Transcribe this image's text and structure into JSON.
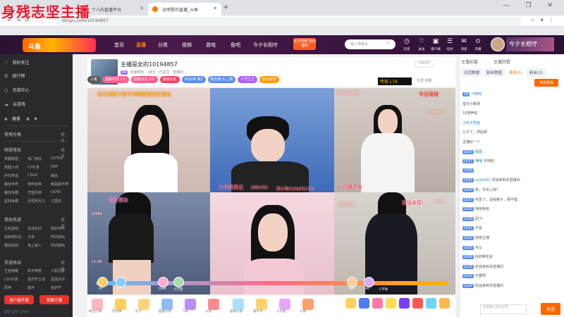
{
  "overlay_title": "身残志坚主播",
  "browser": {
    "tabs": [
      {
        "label": "个人的直播平台"
      },
      {
        "label": "全明星的直播_斗鱼"
      }
    ],
    "url": "douyu.com/10194857",
    "new_tab": "+",
    "window_controls": "— ❐ ✕"
  },
  "header": {
    "logo_text": "斗鱼",
    "nav": [
      "首页",
      "直播",
      "分类",
      "视频",
      "游戏",
      "鱼吧",
      "今夕长相守"
    ],
    "rank_pill": "五月冲榜 活动福利",
    "search_placeholder": "输入搜索关",
    "icons": [
      {
        "icon": "history-icon",
        "label": "历史"
      },
      {
        "icon": "follow-icon",
        "label": "关注"
      },
      {
        "icon": "broadcast-icon",
        "label": "客户端"
      },
      {
        "icon": "task-icon",
        "label": "任务"
      },
      {
        "icon": "message-icon",
        "label": "消息"
      },
      {
        "icon": "location-icon",
        "label": "开播"
      }
    ],
    "banner_text": "今夕长相守"
  },
  "sidebar": {
    "items": [
      {
        "icon": "heart-icon",
        "label": "我的关注"
      },
      {
        "icon": "rank-icon",
        "label": "排行榜"
      },
      {
        "icon": "page-icon",
        "label": "页游中心"
      },
      {
        "icon": "cloud-icon",
        "label": "云游戏"
      },
      {
        "icon": "recommend-icon",
        "label": "赛事"
      }
    ],
    "sections": [
      {
        "title": "常用分类",
        "more": "更多",
        "cells": []
      },
      {
        "title": "网游竞技",
        "more": "更多",
        "cells": [
          "英雄联盟",
          "热门游戏",
          "DOTA2",
          "穿越火线",
          "CF手游",
          "DNF",
          "炉石传说",
          "CSGO",
          "魔兽",
          "魔兽世界",
          "使命召唤",
          "暗黑破坏神",
          "魔兽争霸",
          "守望先锋",
          "DOTA",
          "星际争霸",
          "天涯明月刀",
          "三国杀"
        ]
      },
      {
        "title": "单机热游",
        "more": "更多",
        "cells": [
          "主机游戏",
          "永劫无间",
          "我的世界",
          "逃离塔科夫",
          "方舟",
          "怀旧游戏",
          "模拟游戏",
          "海上狼人",
          "怀旧游戏"
        ]
      },
      {
        "title": "手游休闲",
        "more": "更多",
        "cells": [
          "王者荣耀",
          "和平精英",
          "火影忍者",
          "LOL手游",
          "金铲铲之战",
          "蛋蛋派对",
          "原神",
          "崩坏",
          "金铲铲"
        ]
      }
    ],
    "client_button": "客户端开播",
    "download_button": "我要开播",
    "footer": "版权   互动   12345"
  },
  "room": {
    "title": "主播是女的10194857",
    "tags": [
      "49",
      "全能陪玩",
      "28万",
      "已关注",
      "直播间"
    ],
    "follow_count": "10605",
    "hot": "传奇 L76",
    "share": "分享  举报",
    "pills": [
      {
        "label": "小鬼",
        "color": "#555555"
      },
      {
        "label": "温柔可爱 2人",
        "color": "#ff5d8f"
      },
      {
        "label": "超级女友 3人",
        "color": "#ff5d8f"
      },
      {
        "label": "超级女友",
        "color": "#ff3b66"
      },
      {
        "label": "PK女神 第2",
        "color": "#5b8def"
      },
      {
        "label": "粉丝牌 头上牌",
        "color": "#5b8def"
      },
      {
        "label": "人气之王",
        "color": "#b05cff"
      },
      {
        "label": "粉丝宠爱",
        "color": "#ff9a00"
      }
    ]
  },
  "video": {
    "overlays": [
      "任乐满家大哥今年都能找到女朋友",
      "DY乐爱恩恩",
      "今日双倍",
      "10194857",
      "小贝西贡记",
      "(68235)",
      "苏小鱼(10625274)",
      "一只橘子安",
      "找女朋友",
      "找女朋友",
      "双倍亲密!",
      "七夕大",
      "2/999",
      "11:06"
    ],
    "bottom_users": [
      "61",
      "51",
      "100K",
      "小贝西",
      "289",
      "60",
      "C不啦"
    ]
  },
  "gifts": [
    "粉丝灯牌",
    "荧光棒",
    "办卡",
    "超级火箭",
    "飞机",
    "火箭",
    "超级火箭",
    "嘉年华",
    "小火箭",
    "火锅"
  ],
  "chat": {
    "title_tabs": [
      "主播招募",
      "主播回看"
    ],
    "tabs": [
      "日活数据",
      "粉丝数据",
      "贵宾(1)",
      "粉丝(2)"
    ],
    "tab_button": "开通贵族",
    "messages": [
      {
        "lvl": "19",
        "name": "飞奔吧",
        "text": ""
      },
      {
        "lvl": "",
        "name": "",
        "text": "蛋仔小剧场"
      },
      {
        "lvl": "",
        "name": "",
        "text": "10倍声效"
      },
      {
        "lvl": "",
        "name": "小鸡子吃饭",
        "text": ""
      },
      {
        "lvl": "",
        "name": "",
        "text": "七夕了，然后呢"
      },
      {
        "lvl": "",
        "name": "",
        "text": "主播好一个"
      },
      {
        "lvl": "LV30",
        "name": "碰碰",
        "text": ""
      },
      {
        "lvl": "LV27",
        "name": "嘎嘎",
        "text": "乐呵的"
      },
      {
        "lvl": "LV20",
        "name": "",
        "text": ""
      },
      {
        "lvl": "LV21",
        "name": "xyy0102",
        "text": "欢迎来到本直播间"
      },
      {
        "lvl": "LV20",
        "name": "",
        "text": "我，今天心情？"
      },
      {
        "lvl": "LV17",
        "name": "",
        "text": "可爱了，没有鞋子，那不错"
      },
      {
        "lvl": "LV15",
        "name": "",
        "text": "哈哈哈哈"
      },
      {
        "lvl": "LV19",
        "name": "",
        "text": "回飞"
      },
      {
        "lvl": "LV22",
        "name": "",
        "text": "不是"
      },
      {
        "lvl": "LV22",
        "name": "",
        "text": "感谢主播"
      },
      {
        "lvl": "LV25",
        "name": "",
        "text": "可以"
      },
      {
        "lvl": "LV16",
        "name": "",
        "text": "好的啊年龄"
      },
      {
        "lvl": "LV16",
        "name": "",
        "text": "欢迎来到本直播间"
      },
      {
        "lvl": "LV15",
        "name": "",
        "text": "不要呀"
      },
      {
        "lvl": "LV24",
        "name": "",
        "text": "欢迎来到本直播间"
      }
    ],
    "input_placeholder": "这里输入发言文字",
    "send_label": "发送"
  }
}
